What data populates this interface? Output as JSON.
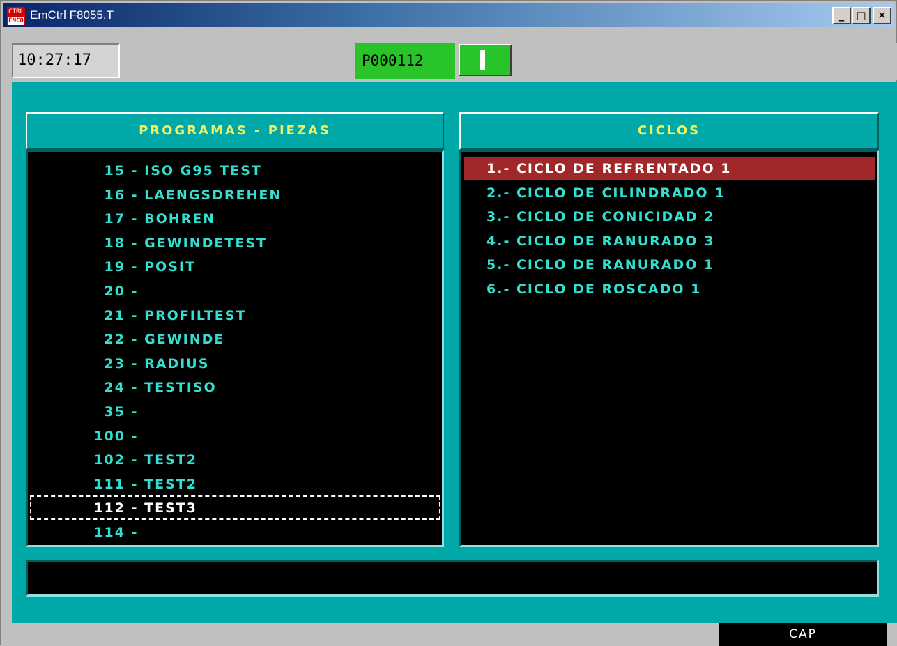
{
  "window": {
    "title": "EmCtrl F8055.T",
    "icon": {
      "top": "CTRL",
      "bottom": "EMCO"
    },
    "controls": {
      "minimize": "_",
      "maximize": "□",
      "close": "✕"
    }
  },
  "topbar": {
    "clock": "10:27:17",
    "program": "P000112"
  },
  "programs": {
    "header": "PROGRAMAS - PIEZAS",
    "items": [
      {
        "number": "15",
        "sep": "-",
        "name": "ISO G95 TEST"
      },
      {
        "number": "16",
        "sep": "-",
        "name": "LAENGSDREHEN"
      },
      {
        "number": "17",
        "sep": "-",
        "name": "BOHREN"
      },
      {
        "number": "18",
        "sep": "-",
        "name": "GEWINDETEST"
      },
      {
        "number": "19",
        "sep": "-",
        "name": "POSIT"
      },
      {
        "number": "20",
        "sep": "-",
        "name": ""
      },
      {
        "number": "21",
        "sep": "-",
        "name": "PROFILTEST"
      },
      {
        "number": "22",
        "sep": "-",
        "name": "GEWINDE"
      },
      {
        "number": "23",
        "sep": "-",
        "name": "RADIUS"
      },
      {
        "number": "24",
        "sep": "-",
        "name": "TESTISO"
      },
      {
        "number": "35",
        "sep": "-",
        "name": ""
      },
      {
        "number": "100",
        "sep": "-",
        "name": ""
      },
      {
        "number": "102",
        "sep": "-",
        "name": "TEST2"
      },
      {
        "number": "111",
        "sep": "-",
        "name": "TEST2"
      },
      {
        "number": "112",
        "sep": "-",
        "name": "TEST3"
      },
      {
        "number": "114",
        "sep": "-",
        "name": ""
      }
    ],
    "selected_number": "112"
  },
  "cycles": {
    "header": "CICLOS",
    "items": [
      "1.- CICLO DE REFRENTADO 1",
      "2.- CICLO DE CILINDRADO 1",
      "3.- CICLO DE CONICIDAD 2",
      "4.- CICLO DE RANURADO 3",
      "5.- CICLO DE RANURADO 1",
      "6.- CICLO DE ROSCADO 1"
    ],
    "active_item": "1.- CICLO DE REFRENTADO 1"
  },
  "message": "",
  "statusbar": {
    "cap": "CAP"
  },
  "colors": {
    "background": "#00a8a8",
    "list_text": "#33e0d0",
    "header_text": "#f0f060",
    "active_cycle": "#a02828",
    "program_indicator": "#29c429"
  }
}
